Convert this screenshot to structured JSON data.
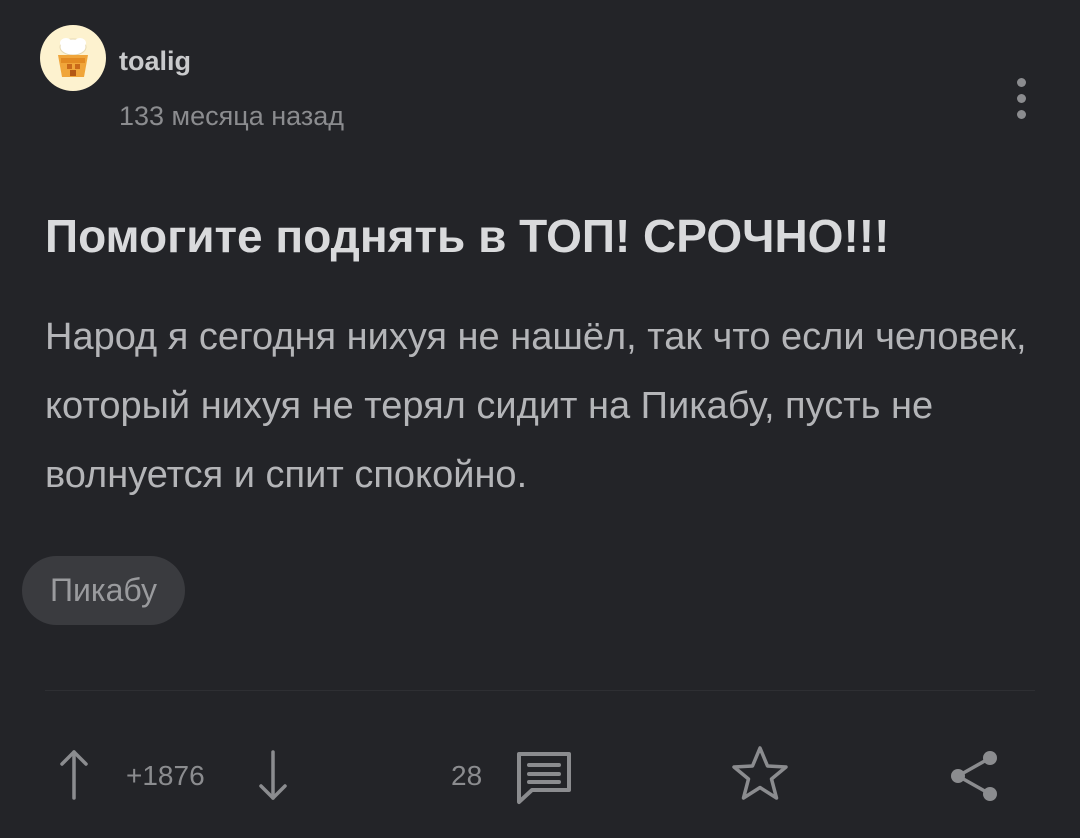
{
  "post": {
    "author": "toalig",
    "time_ago": "133 месяца назад",
    "title": "Помогите поднять в ТОП! СРОЧНО!!!",
    "body": "Народ я сегодня нихуя не нашёл, так что если человек, который нихуя не терял сидит на Пикабу, пусть не волнуется и спит спокойно.",
    "tags": [
      "Пикабу"
    ]
  },
  "actions": {
    "rating": "+1876",
    "comments_count": "28"
  },
  "icons": {
    "menu": "more-vertical-icon",
    "upvote": "arrow-up-icon",
    "downvote": "arrow-down-icon",
    "comments": "comment-icon",
    "save": "star-icon",
    "share": "share-icon"
  },
  "colors": {
    "background": "#232428",
    "title": "#d9dadc",
    "body_text": "#b4b5b8",
    "muted": "#8b8c8f",
    "tag_background": "#3a3b3f",
    "avatar_background": "#fdf2cf"
  }
}
